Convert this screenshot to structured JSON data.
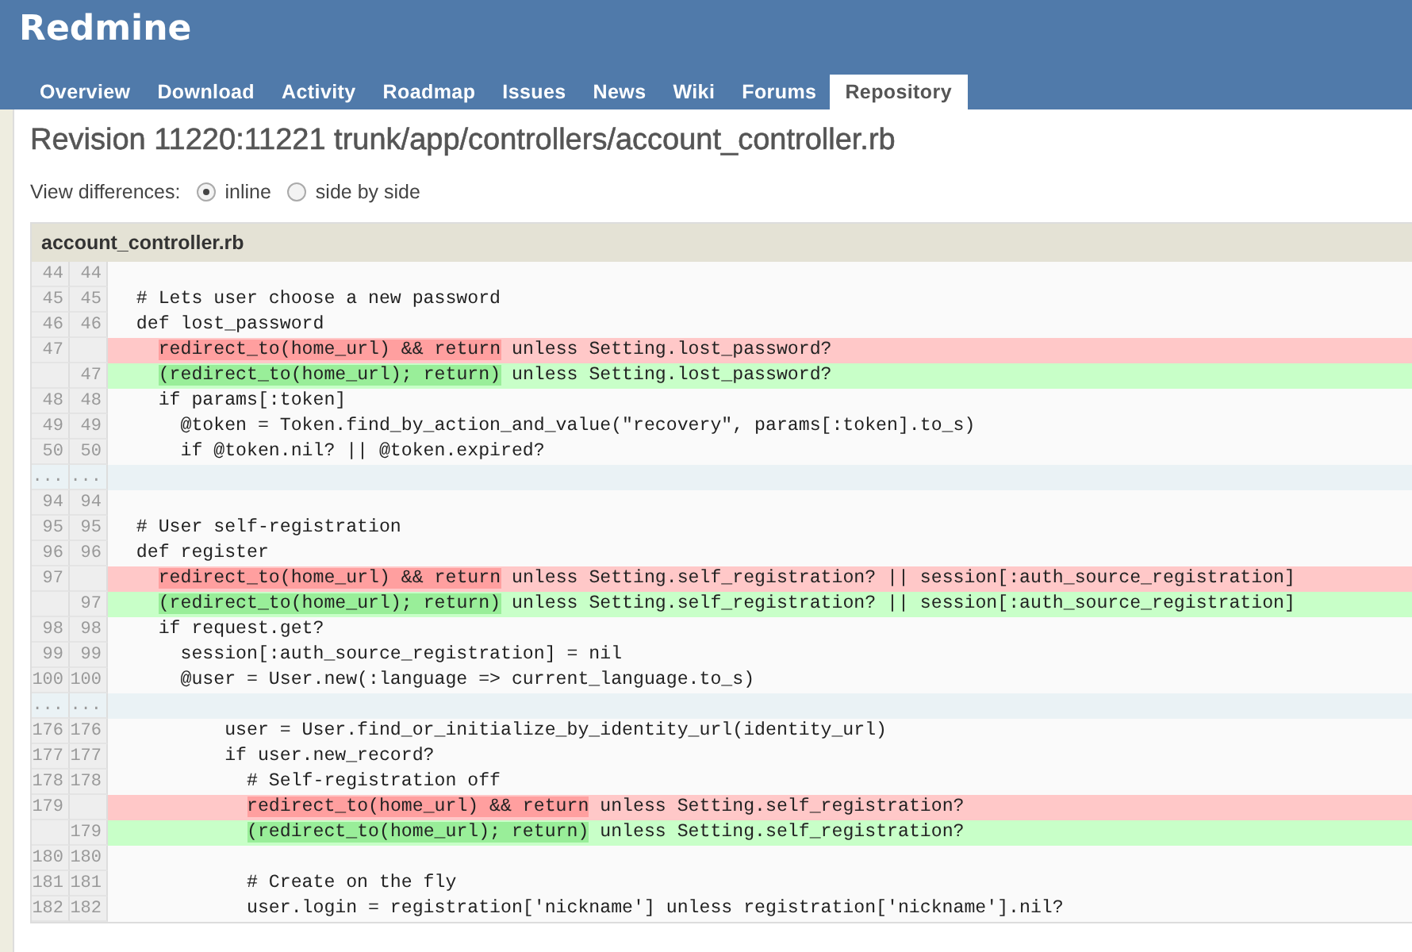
{
  "app_title": "Redmine",
  "tabs": [
    {
      "label": "Overview",
      "selected": false
    },
    {
      "label": "Download",
      "selected": false
    },
    {
      "label": "Activity",
      "selected": false
    },
    {
      "label": "Roadmap",
      "selected": false
    },
    {
      "label": "Issues",
      "selected": false
    },
    {
      "label": "News",
      "selected": false
    },
    {
      "label": "Wiki",
      "selected": false
    },
    {
      "label": "Forums",
      "selected": false
    },
    {
      "label": "Repository",
      "selected": true
    }
  ],
  "page_title": "Revision 11220:11221 trunk/app/controllers/account_controller.rb",
  "view_differences": {
    "label": "View differences:",
    "options": [
      {
        "label": "inline",
        "selected": true
      },
      {
        "label": "side by side",
        "selected": false
      }
    ]
  },
  "diff": {
    "filename": "account_controller.rb",
    "rows": [
      {
        "kind": "context",
        "old": "44",
        "new": "44"
      },
      {
        "kind": "context",
        "old": "45",
        "new": "45",
        "code": "  # Lets user choose a new password"
      },
      {
        "kind": "context",
        "old": "46",
        "new": "46",
        "code": "  def lost_password"
      },
      {
        "kind": "del",
        "old": "47",
        "indent": "    ",
        "changed": "redirect_to(home_url) && return",
        "rest": " unless Setting.lost_password?"
      },
      {
        "kind": "add",
        "new": "47",
        "indent": "    ",
        "changed": "(redirect_to(home_url); return)",
        "rest": " unless Setting.lost_password?"
      },
      {
        "kind": "context",
        "old": "48",
        "new": "48",
        "code": "    if params[:token]"
      },
      {
        "kind": "context",
        "old": "49",
        "new": "49",
        "code": "      @token = Token.find_by_action_and_value(\"recovery\", params[:token].to_s)"
      },
      {
        "kind": "context",
        "old": "50",
        "new": "50",
        "code": "      if @token.nil? || @token.expired?"
      },
      {
        "kind": "sep",
        "old": "...",
        "new": "..."
      },
      {
        "kind": "context",
        "old": "94",
        "new": "94"
      },
      {
        "kind": "context",
        "old": "95",
        "new": "95",
        "code": "  # User self-registration"
      },
      {
        "kind": "context",
        "old": "96",
        "new": "96",
        "code": "  def register"
      },
      {
        "kind": "del",
        "old": "97",
        "indent": "    ",
        "changed": "redirect_to(home_url) && return",
        "rest": " unless Setting.self_registration? || session[:auth_source_registration]"
      },
      {
        "kind": "add",
        "new": "97",
        "indent": "    ",
        "changed": "(redirect_to(home_url); return)",
        "rest": " unless Setting.self_registration? || session[:auth_source_registration]"
      },
      {
        "kind": "context",
        "old": "98",
        "new": "98",
        "code": "    if request.get?"
      },
      {
        "kind": "context",
        "old": "99",
        "new": "99",
        "code": "      session[:auth_source_registration] = nil"
      },
      {
        "kind": "context",
        "old": "100",
        "new": "100",
        "code": "      @user = User.new(:language => current_language.to_s)"
      },
      {
        "kind": "sep",
        "old": "...",
        "new": "..."
      },
      {
        "kind": "context",
        "old": "176",
        "new": "176",
        "code": "          user = User.find_or_initialize_by_identity_url(identity_url)"
      },
      {
        "kind": "context",
        "old": "177",
        "new": "177",
        "code": "          if user.new_record?"
      },
      {
        "kind": "context",
        "old": "178",
        "new": "178",
        "code": "            # Self-registration off"
      },
      {
        "kind": "del",
        "old": "179",
        "indent": "            ",
        "changed": "redirect_to(home_url) && return",
        "rest": " unless Setting.self_registration?"
      },
      {
        "kind": "add",
        "new": "179",
        "indent": "            ",
        "changed": "(redirect_to(home_url); return)",
        "rest": " unless Setting.self_registration?"
      },
      {
        "kind": "context",
        "old": "180",
        "new": "180"
      },
      {
        "kind": "context",
        "old": "181",
        "new": "181",
        "code": "            # Create on the fly"
      },
      {
        "kind": "context",
        "old": "182",
        "new": "182",
        "code": "            user.login = registration['nickname'] unless registration['nickname'].nil?"
      }
    ]
  }
}
